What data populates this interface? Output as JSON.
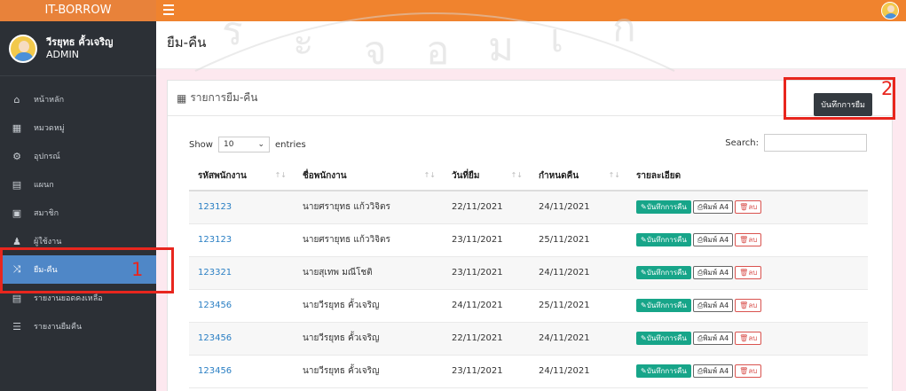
{
  "sidebar": {
    "brand": "IT-BORROW",
    "user_name": "วีรยุทธ คั้วเจริญ",
    "user_role": "ADMIN",
    "items": [
      {
        "label": "หน้าหลัก",
        "icon": "home-icon",
        "glyph": "⌂"
      },
      {
        "label": "หมวดหมู่",
        "icon": "grid-icon",
        "glyph": "▦"
      },
      {
        "label": "อุปกรณ์",
        "icon": "cogs-icon",
        "glyph": "⚙"
      },
      {
        "label": "แผนก",
        "icon": "table-icon",
        "glyph": "▤"
      },
      {
        "label": "สมาชิก",
        "icon": "id-card-icon",
        "glyph": "▣"
      },
      {
        "label": "ผู้ใช้งาน",
        "icon": "user-icon",
        "glyph": "♟"
      },
      {
        "label": "ยืม-คืน",
        "icon": "shuffle-icon",
        "glyph": "⤨",
        "active": true
      },
      {
        "label": "รายงานยอดคงเหลือ",
        "icon": "report-icon",
        "glyph": "▤"
      },
      {
        "label": "รายงานยืมคืน",
        "icon": "list-icon",
        "glyph": "☰"
      }
    ]
  },
  "header": {
    "page_title": "ยืม-คืน"
  },
  "card": {
    "title": "รายการยืม-คืน",
    "add_button": "บันทึกการยืม",
    "show_label": "Show",
    "entries_value": "10",
    "entries_label": "entries",
    "search_label": "Search:",
    "search_value": ""
  },
  "table": {
    "columns": [
      "รหัสพนักงาน",
      "ชื่อพนักงาน",
      "วันที่ยืม",
      "กำหนดคืน",
      "รายละเอียด"
    ],
    "actions": {
      "return": "บันทึกการคืน",
      "print": "พิมพ์ A4",
      "delete": "ลบ"
    },
    "rows": [
      {
        "id": "123123",
        "name": "นายศรายุทธ แก้ววิจิตร",
        "borrow": "22/11/2021",
        "due": "24/11/2021"
      },
      {
        "id": "123123",
        "name": "นายศรายุทธ แก้ววิจิตร",
        "borrow": "23/11/2021",
        "due": "25/11/2021"
      },
      {
        "id": "123321",
        "name": "นายสุเทพ มณีโชติ",
        "borrow": "23/11/2021",
        "due": "24/11/2021"
      },
      {
        "id": "123456",
        "name": "นายวีรยุทธ คั้วเจริญ",
        "borrow": "24/11/2021",
        "due": "25/11/2021"
      },
      {
        "id": "123456",
        "name": "นายวีรยุทธ คั้วเจริญ",
        "borrow": "22/11/2021",
        "due": "24/11/2021"
      },
      {
        "id": "123456",
        "name": "นายวีรยุทธ คั้วเจริญ",
        "borrow": "23/11/2021",
        "due": "24/11/2021"
      }
    ]
  },
  "annotations": {
    "label_1": "1",
    "label_2": "2",
    "color": "#e8261e"
  },
  "colors": {
    "topbar": "#f0832e",
    "sidebar": "#2c3036",
    "active_menu": "#4f87c7",
    "return_button": "#17a589"
  }
}
